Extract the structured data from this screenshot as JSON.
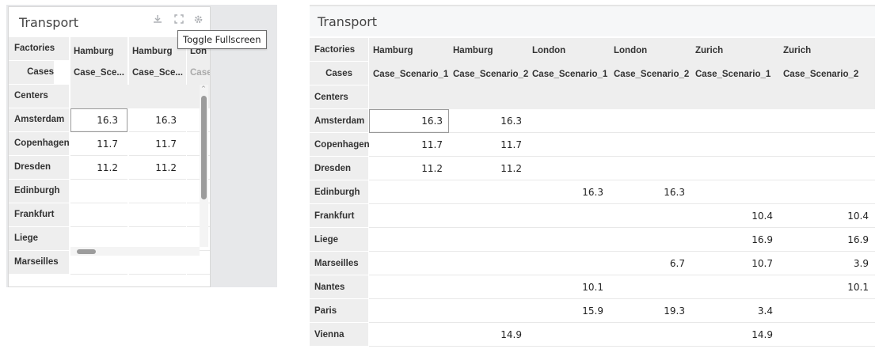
{
  "title": "Transport",
  "tooltip": "Toggle Fullscreen",
  "icons": {
    "download": "download-icon",
    "fullscreen": "fullscreen-icon",
    "settings": "gear-icon"
  },
  "header_labels": {
    "factories": "Factories",
    "cases": "Cases",
    "centers": "Centers"
  },
  "small": {
    "columns": [
      {
        "factory": "Hamburg",
        "case": "Case_Sce..."
      },
      {
        "factory": "Hamburg",
        "case": "Case_Sce..."
      },
      {
        "factory": "Lon",
        "case": "Case"
      }
    ],
    "rows": [
      {
        "center": "Amsterdam",
        "values": [
          "16.3",
          "16.3",
          ""
        ]
      },
      {
        "center": "Copenhagen",
        "values": [
          "11.7",
          "11.7",
          ""
        ]
      },
      {
        "center": "Dresden",
        "values": [
          "11.2",
          "11.2",
          ""
        ]
      },
      {
        "center": "Edinburgh",
        "values": [
          "",
          "",
          ""
        ]
      },
      {
        "center": "Frankfurt",
        "values": [
          "",
          "",
          ""
        ]
      },
      {
        "center": "Liege",
        "values": [
          "",
          "",
          ""
        ]
      },
      {
        "center": "Marseilles",
        "values": [
          "",
          "",
          ""
        ]
      }
    ]
  },
  "big": {
    "columns": [
      {
        "factory": "Hamburg",
        "case": "Case_Scenario_1"
      },
      {
        "factory": "Hamburg",
        "case": "Case_Scenario_2"
      },
      {
        "factory": "London",
        "case": "Case_Scenario_1"
      },
      {
        "factory": "London",
        "case": "Case_Scenario_2"
      },
      {
        "factory": "Zurich",
        "case": "Case_Scenario_1"
      },
      {
        "factory": "Zurich",
        "case": "Case_Scenario_2"
      }
    ],
    "rows": [
      {
        "center": "Amsterdam",
        "values": [
          "16.3",
          "16.3",
          "",
          "",
          "",
          ""
        ]
      },
      {
        "center": "Copenhagen",
        "values": [
          "11.7",
          "11.7",
          "",
          "",
          "",
          ""
        ]
      },
      {
        "center": "Dresden",
        "values": [
          "11.2",
          "11.2",
          "",
          "",
          "",
          ""
        ]
      },
      {
        "center": "Edinburgh",
        "values": [
          "",
          "",
          "16.3",
          "16.3",
          "",
          ""
        ]
      },
      {
        "center": "Frankfurt",
        "values": [
          "",
          "",
          "",
          "",
          "10.4",
          "10.4"
        ]
      },
      {
        "center": "Liege",
        "values": [
          "",
          "",
          "",
          "",
          "16.9",
          "16.9"
        ]
      },
      {
        "center": "Marseilles",
        "values": [
          "",
          "",
          "",
          "6.7",
          "10.7",
          "3.9"
        ]
      },
      {
        "center": "Nantes",
        "values": [
          "",
          "",
          "10.1",
          "",
          "",
          "10.1"
        ]
      },
      {
        "center": "Paris",
        "values": [
          "",
          "",
          "15.9",
          "19.3",
          "3.4",
          ""
        ]
      },
      {
        "center": "Vienna",
        "values": [
          "",
          "14.9",
          "",
          "",
          "14.9",
          ""
        ]
      }
    ]
  }
}
